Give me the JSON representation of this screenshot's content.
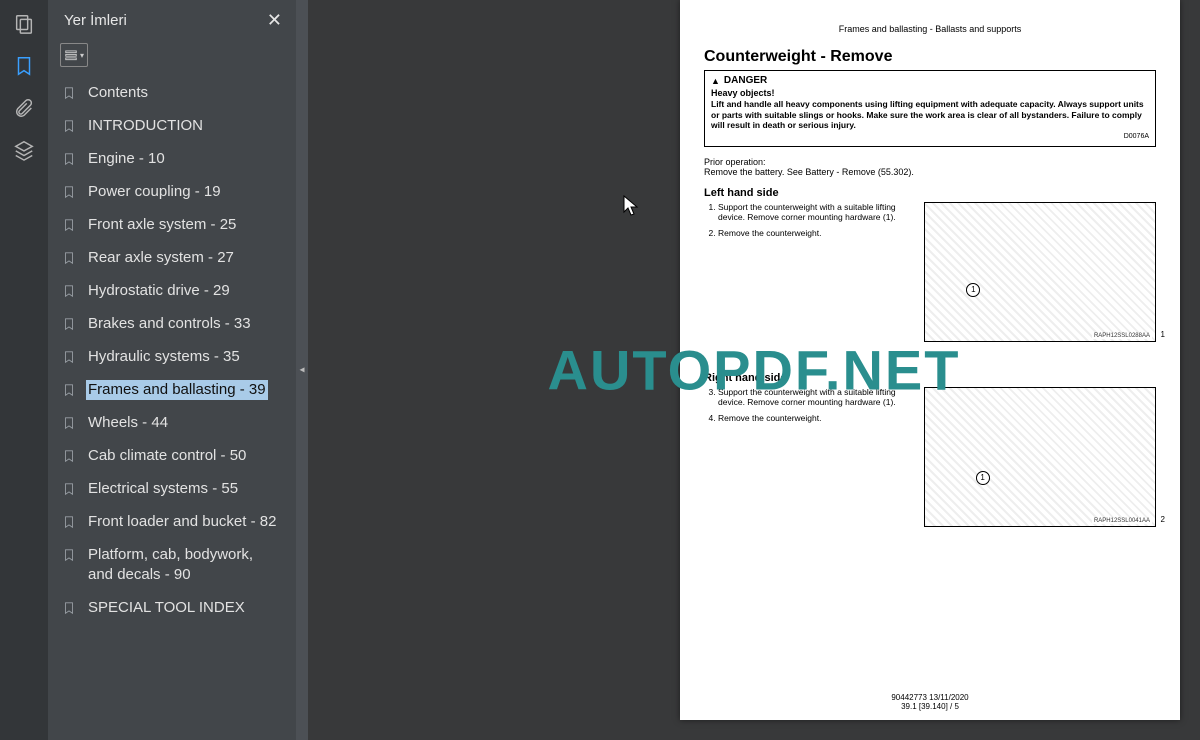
{
  "rail": {
    "items": [
      {
        "name": "thumbnails-icon"
      },
      {
        "name": "bookmarks-icon",
        "active": true
      },
      {
        "name": "attachments-icon"
      },
      {
        "name": "layers-icon"
      }
    ]
  },
  "panel": {
    "title": "Yer İmleri",
    "close_label": "✕"
  },
  "bookmarks": [
    {
      "label": "Contents"
    },
    {
      "label": "INTRODUCTION"
    },
    {
      "label": "Engine - 10"
    },
    {
      "label": "Power coupling - 19"
    },
    {
      "label": "Front axle system - 25"
    },
    {
      "label": "Rear axle system - 27"
    },
    {
      "label": "Hydrostatic drive - 29"
    },
    {
      "label": "Brakes and controls - 33"
    },
    {
      "label": "Hydraulic systems - 35"
    },
    {
      "label": "Frames and ballasting - 39",
      "selected": true
    },
    {
      "label": "Wheels - 44"
    },
    {
      "label": "Cab climate control - 50"
    },
    {
      "label": "Electrical systems - 55"
    },
    {
      "label": "Front loader and bucket - 82"
    },
    {
      "label": "Platform, cab, bodywork, and decals - 90"
    },
    {
      "label": "SPECIAL TOOL INDEX"
    }
  ],
  "watermark": "AUTOPDF.NET",
  "doc": {
    "breadcrumb": "Frames and ballasting - Ballasts and supports",
    "title": "Counterweight - Remove",
    "danger": {
      "heading": "DANGER",
      "heavy": "Heavy objects!",
      "body": "Lift and handle all heavy components using lifting equipment with adequate capacity. Always support units or parts with suitable slings or hooks. Make sure the work area is clear of all bystanders. Failure to comply will result in death or serious injury.",
      "code": "D0076A"
    },
    "prior_label": "Prior operation:",
    "prior_text": "Remove the battery. See Battery - Remove (55.302).",
    "left": {
      "heading": "Left hand side",
      "step1": "Support the counterweight with a suitable lifting device. Remove corner mounting hardware (1).",
      "step2": "Remove the counterweight.",
      "figcap": "RAPH12SSL0288AA",
      "fignum": "1"
    },
    "right": {
      "heading": "Right hand side",
      "step3": "Support the counterweight with a suitable lifting device. Remove corner mounting hardware (1).",
      "step4": "Remove the counterweight.",
      "figcap": "RAPH12SSL0041AA",
      "fignum": "2"
    },
    "footer_line1": "90442773 13/11/2020",
    "footer_line2": "39.1 [39.140] / 5"
  }
}
